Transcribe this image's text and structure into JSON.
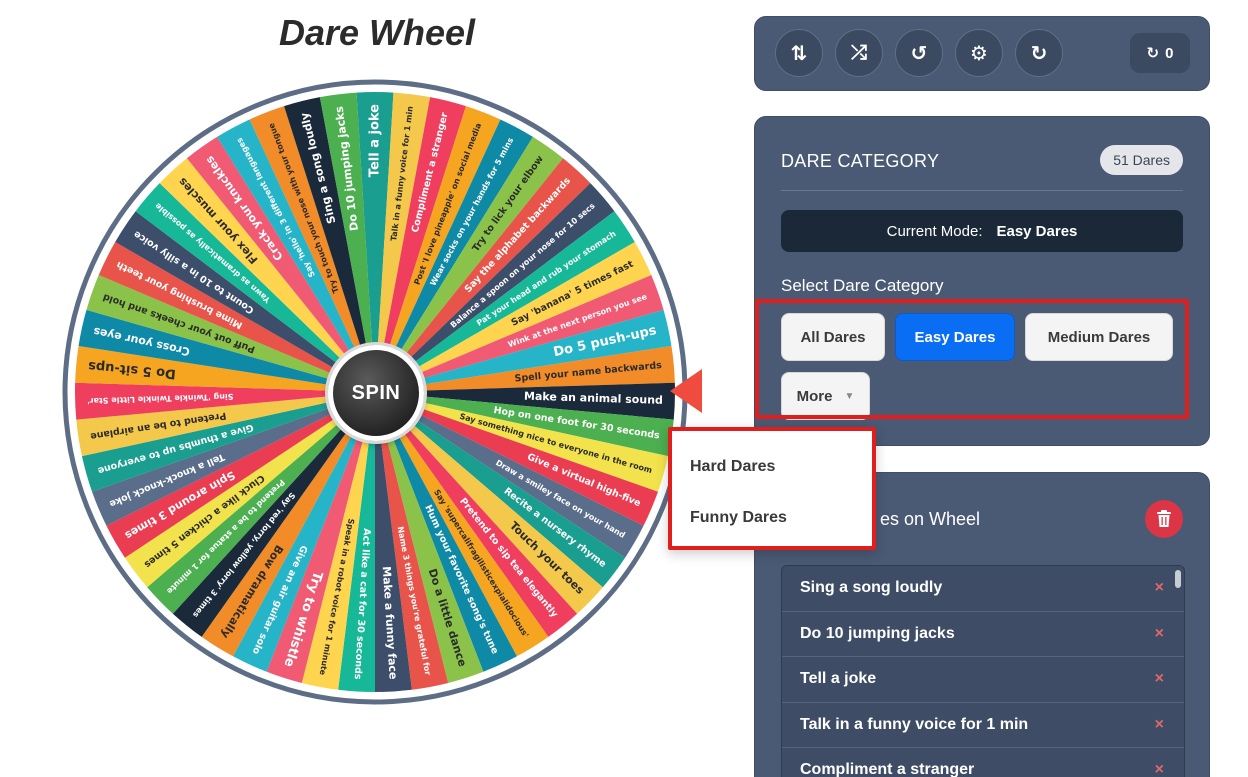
{
  "page": {
    "title": "Dare Wheel"
  },
  "wheel": {
    "spin_label": "SPIN",
    "dares": [
      "Tell a joke",
      "Talk in a funny voice for 1 min",
      "Compliment a stranger",
      "Post 'I love pineapple' on social media",
      "Wear socks on your hands for 5 mins",
      "Try to lick your elbow",
      "Say the alphabet backwards",
      "Balance a spoon on your nose for 10 secs",
      "Pat your head and rub your stomach",
      "Say 'banana' 5 times fast",
      "Wink at the next person you see",
      "Do 5 push-ups",
      "Spell your name backwards",
      "Make an animal sound",
      "Hop on one foot for 30 seconds",
      "Say something nice to everyone in the room",
      "Give a virtual high-five",
      "Draw a smiley face on your hand",
      "Recite a nursery rhyme",
      "Touch your toes",
      "Pretend to sip tea elegantly",
      "Say 'supercalifragilisticexpialidocious'",
      "Hum your favorite song's tune",
      "Do a little dance",
      "Name 3 things you're grateful for",
      "Make a funny face",
      "Act like a cat for 30 seconds",
      "Speak in a robot voice for 1 minute",
      "Try to whistle",
      "Give an air guitar solo",
      "Bow dramatically",
      "Say 'red lorry, yellow lorry' 3 times",
      "Pretend to be a statue for 1 minute",
      "Cluck like a chicken 5 times",
      "Spin around 3 times",
      "Tell a knock-knock joke",
      "Give a thumbs up to everyone",
      "Pretend to be an airplane",
      "Sing 'Twinkle Twinkle Little Star'",
      "Do 5 sit-ups",
      "Cross your eyes",
      "Puff out your cheeks and hold",
      "Mime brushing your teeth",
      "Count to 10 in a silly voice",
      "Yawn as dramatically as possible",
      "Flex your muscles",
      "Crack your knuckles",
      "Say 'hello' in 3 different languages",
      "Try to touch your nose with your tongue",
      "Sing a song loudly",
      "Do 10 jumping jacks"
    ]
  },
  "toolbar": {
    "buttons": [
      {
        "icon": "sort-icon",
        "glyph": "⇅"
      },
      {
        "icon": "shuffle-icon",
        "glyph": "⤮"
      },
      {
        "icon": "history-icon",
        "glyph": "↺"
      },
      {
        "icon": "gear-icon",
        "glyph": "⚙"
      },
      {
        "icon": "redo-icon",
        "glyph": "↻"
      }
    ],
    "counter_value": "0"
  },
  "category_panel": {
    "heading": "DARE CATEGORY",
    "count_badge": "51 Dares",
    "mode_label": "Current Mode:",
    "mode_value": "Easy Dares",
    "select_label": "Select Dare Category",
    "buttons": {
      "all": "All Dares",
      "easy": "Easy Dares",
      "medium": "Medium Dares",
      "more": "More"
    },
    "dropdown": {
      "hard": "Hard Dares",
      "funny": "Funny Dares"
    }
  },
  "list_panel": {
    "heading": "es on Wheel",
    "remove_glyph": "×",
    "items": [
      "Sing a song loudly",
      "Do 10 jumping jacks",
      "Tell a joke",
      "Talk in a funny voice for 1 min",
      "Compliment a stranger"
    ]
  },
  "colors": {
    "segments": [
      "#1a9e8f",
      "#f3c84b",
      "#ef3e5e",
      "#f6a521",
      "#0f8aa6",
      "#8bc34a",
      "#e8544a",
      "#3d4e6b",
      "#17b897",
      "#ffd54f",
      "#f05a73",
      "#26b4c8",
      "#f28c28",
      "#1b2a3a",
      "#4caf50",
      "#f2e24b",
      "#ea3d52",
      "#5a6d8a"
    ],
    "accent": "#0a6ef5",
    "pointer": "#ef4b3f",
    "panel": "#4a5a74",
    "highlight": "#e01e1e"
  }
}
